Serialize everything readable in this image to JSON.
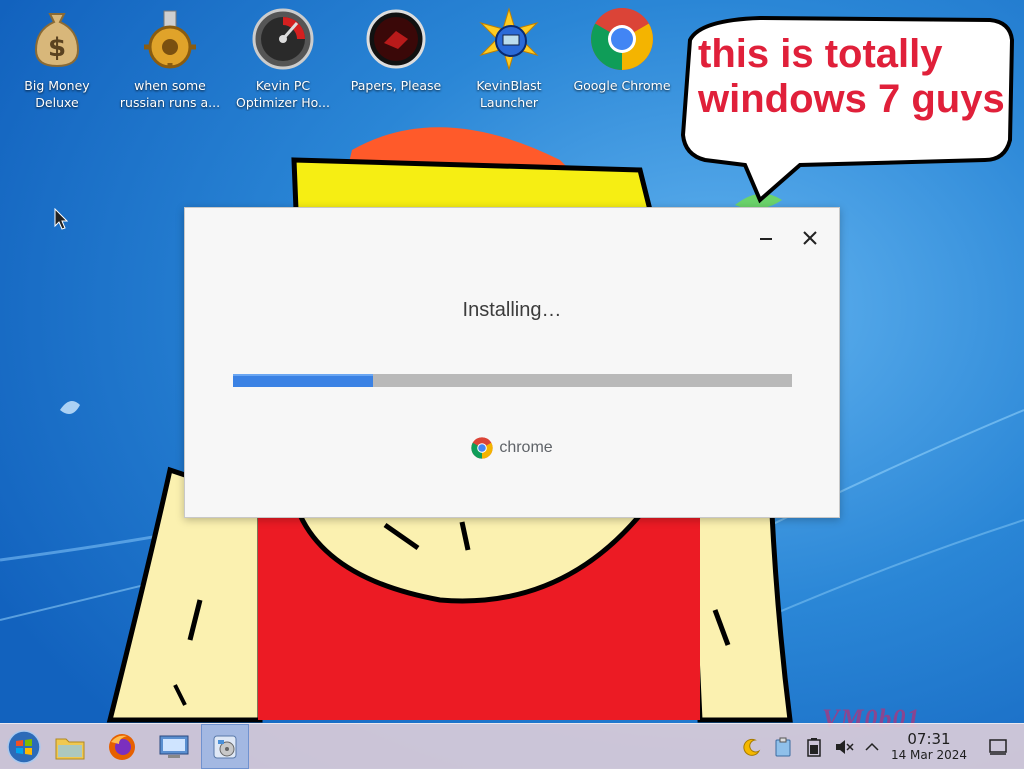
{
  "desktop": {
    "icons": [
      {
        "label": "Big Money\nDeluxe",
        "icon": "money-bag-icon"
      },
      {
        "label": "when some\nrussian runs a...",
        "icon": "gear-icon"
      },
      {
        "label": "Kevin PC\nOptimizer Ho...",
        "icon": "speedometer-icon"
      },
      {
        "label": "Papers, Please",
        "icon": "papers-please-icon"
      },
      {
        "label": "KevinBlast\nLauncher",
        "icon": "kevinblast-icon"
      },
      {
        "label": "Google Chrome",
        "icon": "chrome-icon"
      }
    ],
    "bubble_text": "this is totally windows 7 guys",
    "watermark": "VM0b01"
  },
  "installer": {
    "status": "Installing…",
    "progress": 0.25,
    "brand": "chrome",
    "minimize_icon": "minimize-icon",
    "close_icon": "close-icon",
    "accent": "#3b82e4"
  },
  "taskbar": {
    "items": [
      {
        "icon": "start-orb-icon",
        "active": false
      },
      {
        "icon": "file-manager-icon",
        "active": false
      },
      {
        "icon": "firefox-icon",
        "active": false
      },
      {
        "icon": "system-settings-icon",
        "active": false
      },
      {
        "icon": "installer-app-icon",
        "active": true
      }
    ],
    "tray": [
      "night-color-icon",
      "clipboard-icon",
      "battery-icon",
      "volume-muted-icon",
      "chevron-up-icon",
      "show-desktop-icon"
    ],
    "clock": {
      "time": "07:31",
      "date": "14 Mar 2024"
    }
  }
}
